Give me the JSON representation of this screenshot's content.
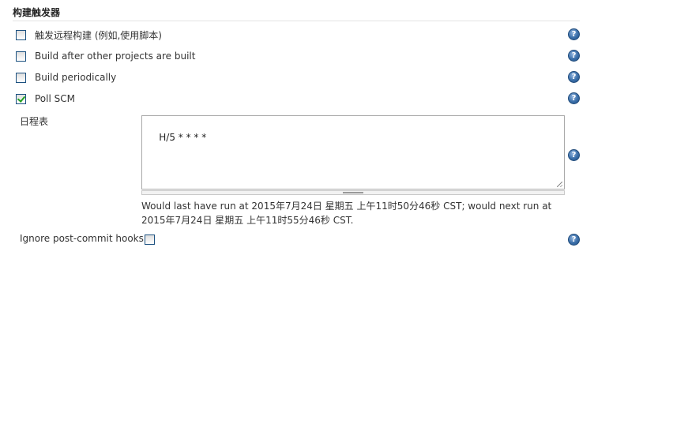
{
  "section": {
    "title": "构建触发器"
  },
  "triggers": [
    {
      "label": "触发远程构建 (例如,使用脚本)",
      "checked": false
    },
    {
      "label": "Build after other projects are built",
      "checked": false
    },
    {
      "label": "Build periodically",
      "checked": false
    },
    {
      "label": "Poll SCM",
      "checked": true
    }
  ],
  "schedule": {
    "label": "日程表",
    "value": "H/5 * * * *",
    "info_line1": "Would last have run at 2015年7月24日 星期五 上午11时50分46秒 CST; would next run at",
    "info_line2": "2015年7月24日 星期五 上午11时55分46秒 CST."
  },
  "ignore_hooks": {
    "label": "Ignore post-commit hooks",
    "checked": false
  },
  "help_icon": {
    "glyph": "?",
    "icon": "help-icon"
  },
  "colors": {
    "help": "#3a6ea8",
    "checkmark": "#21a121",
    "checkbox_border": "#1c5180"
  }
}
